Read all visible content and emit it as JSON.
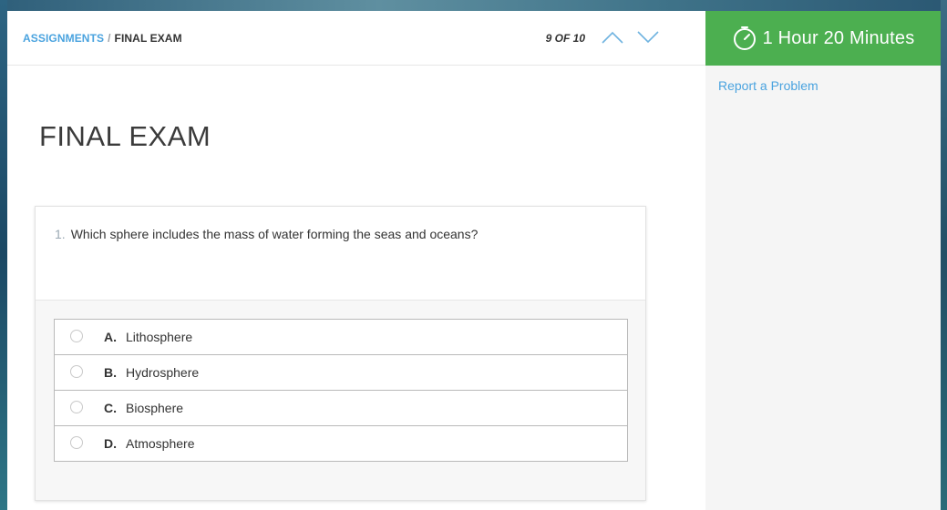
{
  "breadcrumb": {
    "parent": "ASSIGNMENTS",
    "separator": "/",
    "current": "FINAL EXAM"
  },
  "pager": {
    "progress_text": "9 OF 10",
    "prev_icon": "chevron-up-icon",
    "next_icon": "chevron-down-icon"
  },
  "page": {
    "title": "FINAL EXAM"
  },
  "question": {
    "number": "1.",
    "text": "Which sphere includes the mass of water forming the seas and oceans?",
    "options": [
      {
        "letter": "A.",
        "label": "Lithosphere",
        "selected": false
      },
      {
        "letter": "B.",
        "label": "Hydrosphere",
        "selected": false
      },
      {
        "letter": "C.",
        "label": "Biosphere",
        "selected": false
      },
      {
        "letter": "D.",
        "label": "Atmosphere",
        "selected": false
      }
    ]
  },
  "sidebar": {
    "timer_text": "1 Hour 20 Minutes",
    "timer_icon": "stopwatch-icon",
    "report_link": "Report a Problem"
  },
  "colors": {
    "accent_link": "#4aa3df",
    "timer_green": "#4caf50",
    "chevron_blue": "#6fb3e0"
  }
}
